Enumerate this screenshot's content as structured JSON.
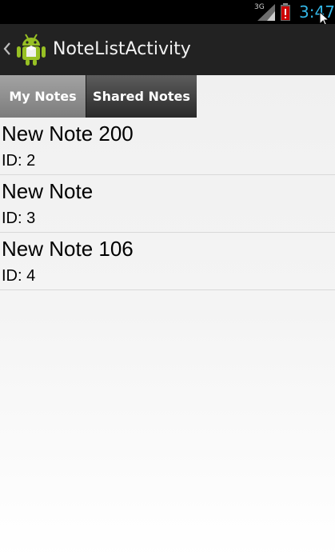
{
  "status_bar": {
    "network_type": "3G",
    "time": "3:47",
    "signal_icon": "signal-icon",
    "battery_icon": "battery-low-icon",
    "battery_color": "#cc0000",
    "clock_color": "#33b5e5"
  },
  "action_bar": {
    "title": "NoteListActivity",
    "up_icon": "chevron-left-icon",
    "app_icon": "android-robot-icon"
  },
  "tabs": [
    {
      "label": "My Notes",
      "selected": true
    },
    {
      "label": "Shared Notes",
      "selected": false
    }
  ],
  "notes": [
    {
      "title": "New Note 200",
      "id_text": "ID: 2"
    },
    {
      "title": "New Note",
      "id_text": "ID: 3"
    },
    {
      "title": "New Note 106",
      "id_text": "ID: 4"
    }
  ]
}
